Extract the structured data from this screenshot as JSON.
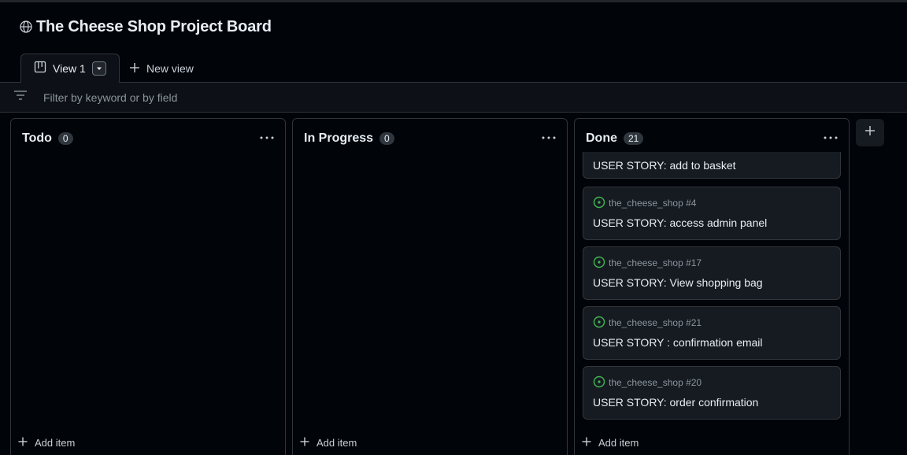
{
  "board": {
    "title": "The Cheese Shop Project Board",
    "globe_icon": "globe-icon"
  },
  "tabs": {
    "active_view": "View 1",
    "new_view_label": "New view"
  },
  "filter": {
    "placeholder": "Filter by keyword or by field"
  },
  "columns": [
    {
      "title": "Todo",
      "count": "0",
      "add_label": "Add item",
      "cards": []
    },
    {
      "title": "In Progress",
      "count": "0",
      "add_label": "Add item",
      "cards": []
    },
    {
      "title": "Done",
      "count": "21",
      "add_label": "Add item",
      "cards": [
        {
          "meta": "",
          "title": "USER STORY: add to basket"
        },
        {
          "meta": "the_cheese_shop #4",
          "title": "USER STORY: access admin panel"
        },
        {
          "meta": "the_cheese_shop #17",
          "title": "USER STORY: View shopping bag"
        },
        {
          "meta": "the_cheese_shop #21",
          "title": "USER STORY : confirmation email"
        },
        {
          "meta": "the_cheese_shop #20",
          "title": "USER STORY: order confirmation"
        }
      ]
    }
  ],
  "colors": {
    "background": "#010409",
    "border": "#30363d",
    "card": "#161b22",
    "done_status": "#3fb950",
    "muted_text": "#8b949e"
  }
}
